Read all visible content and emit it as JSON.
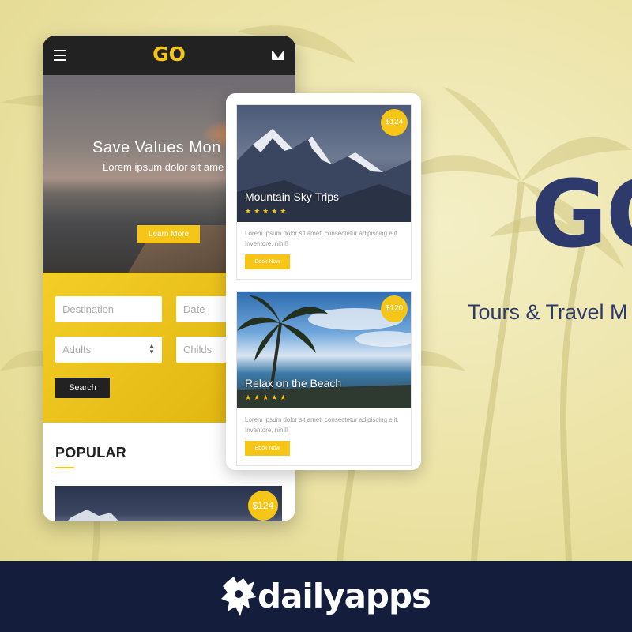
{
  "brand": {
    "name": "GO",
    "tagline": "Tours & Travel M"
  },
  "app": {
    "logo": "GO",
    "hero": {
      "title": "Save Values Mon",
      "subtitle": "Lorem ipsum dolor sit ame",
      "button_label": "Learn More"
    },
    "search": {
      "destination_placeholder": "Destination",
      "date_placeholder": "Date",
      "adults_placeholder": "Adults",
      "childs_placeholder": "Childs",
      "search_label": "Search"
    },
    "popular": {
      "heading": "POPULAR",
      "first_price": "$124"
    }
  },
  "cards": [
    {
      "title": "Mountain Sky Trips",
      "price": "$124",
      "stars": "★★★★★",
      "description": "Lorem ipsum dolor sit amet, consectetur adipiscing elit. Inventore, nihil!",
      "button_label": "Book Now"
    },
    {
      "title": "Relax on the Beach",
      "price": "$120",
      "stars": "★★★★★",
      "description": "Lorem ipsum dolor sit amet, consectetur adipiscing elit. Inventore, nihil!",
      "button_label": "Book Now"
    }
  ],
  "footer": {
    "text": "dailyapps"
  },
  "colors": {
    "accent": "#f5c518",
    "dark": "#222222",
    "navy": "#2d3a6b",
    "footer_bg": "#141d3b"
  },
  "icons": [
    "menu-icon",
    "mail-icon",
    "stepper-icon",
    "dailyapps-logo-icon"
  ]
}
